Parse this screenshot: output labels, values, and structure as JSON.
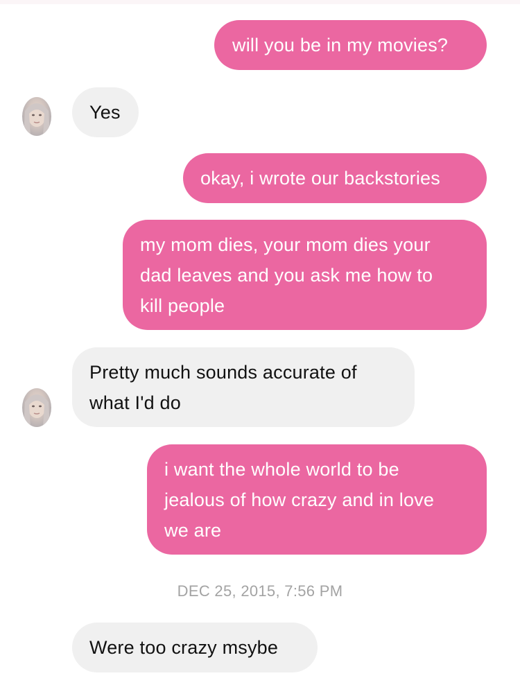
{
  "conversation": {
    "messages": [
      {
        "from": "me",
        "lines": [
          "will you be in my movies?"
        ]
      },
      {
        "from": "them",
        "lines": [
          "Yes"
        ]
      },
      {
        "from": "me",
        "lines": [
          "okay, i wrote our backstories"
        ]
      },
      {
        "from": "me",
        "lines": [
          "my mom dies, your mom dies your",
          "dad leaves and you ask me how to",
          "kill people"
        ]
      },
      {
        "from": "them",
        "lines": [
          "Pretty much sounds accurate of",
          "what I'd do"
        ]
      },
      {
        "from": "me",
        "lines": [
          "i want the whole world to be",
          "jealous of how crazy and in love",
          "we are"
        ]
      },
      {
        "from": "them",
        "lines": [
          "Were too crazy msybe"
        ]
      }
    ],
    "timestamp": "DEC 25, 2015, 7:56 PM"
  },
  "colors": {
    "sent_bubble": "#eb67a1",
    "received_bubble": "#f0f0f0",
    "timestamp_text": "#a3a3a3"
  },
  "icons": {
    "avatar": "contact-avatar-icon"
  }
}
